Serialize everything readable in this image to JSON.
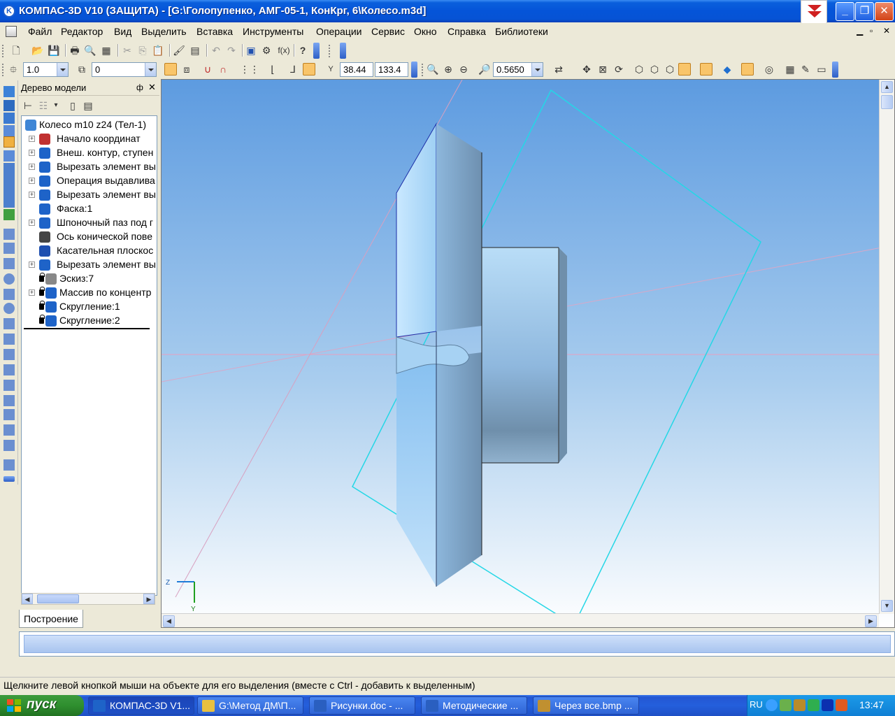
{
  "window": {
    "title": "КОМПАС-3D V10 (ЗАЩИТА) - [G:\\Голопупенко, АМГ-05-1, КонКрг, 6\\Колесо.m3d]",
    "app_icon_letter": "K"
  },
  "menubar": {
    "items": [
      "Файл",
      "Редактор",
      "Вид",
      "Выделить",
      "Вставка",
      "Инструменты",
      "Операции",
      "Сервис",
      "Окно",
      "Справка",
      "Библиотеки"
    ]
  },
  "toolbar2": {
    "step_value": "1.0",
    "layer_value": "0",
    "coord_x": "38.44",
    "coord_y": "133.4",
    "zoom_value": "0.5650",
    "fx_label": "f(x)"
  },
  "model_tree": {
    "header": "Дерево модели",
    "pin_glyph": "ф",
    "root": "Колесо m10 z24 (Тел-1)",
    "items": [
      {
        "label": "Начало координат",
        "expandable": true,
        "locked": false
      },
      {
        "label": "Внеш. контур, ступен",
        "expandable": true,
        "locked": false
      },
      {
        "label": "Вырезать элемент вы",
        "expandable": true,
        "locked": false
      },
      {
        "label": "Операция выдавлива",
        "expandable": true,
        "locked": false
      },
      {
        "label": "Вырезать элемент вы",
        "expandable": true,
        "locked": false
      },
      {
        "label": "Фаска:1",
        "expandable": false,
        "locked": false
      },
      {
        "label": "Шпоночный паз под г",
        "expandable": true,
        "locked": false
      },
      {
        "label": "Ось конической пове",
        "expandable": false,
        "locked": false
      },
      {
        "label": "Касательная плоскос",
        "expandable": false,
        "locked": false
      },
      {
        "label": "Вырезать элемент вы",
        "expandable": true,
        "locked": false
      },
      {
        "label": "Эскиз:7",
        "expandable": false,
        "locked": true
      },
      {
        "label": "Массив по концентр",
        "expandable": true,
        "locked": true
      },
      {
        "label": "Скругление:1",
        "expandable": false,
        "locked": true
      },
      {
        "label": "Скругление:2",
        "expandable": false,
        "locked": true
      }
    ],
    "tab": "Построение"
  },
  "viewport": {
    "axis_z": "Z",
    "axis_y": "Y"
  },
  "status": {
    "prompt": "Щелкните левой кнопкой мыши на объекте для его выделения (вместе с Ctrl - добавить к выделенным)"
  },
  "taskbar": {
    "start_label": "пуск",
    "tasks": [
      {
        "label": "КОМПАС-3D V1...",
        "active": true,
        "icon": "kompas-icon"
      },
      {
        "label": "G:\\Метод ДМ\\П...",
        "active": false,
        "icon": "folder-icon"
      },
      {
        "label": "Рисунки.doc - ...",
        "active": false,
        "icon": "word-icon"
      },
      {
        "label": "Методические ...",
        "active": false,
        "icon": "word-icon"
      },
      {
        "label": "Через все.bmp ...",
        "active": false,
        "icon": "paint-icon"
      }
    ],
    "lang": "RU",
    "clock": "13:47"
  },
  "colors": {
    "viewport_top": "#5d9be0",
    "viewport_bottom": "#ffffff",
    "plane_outline": "#24d7e6",
    "pink_line": "#e8a0c0",
    "part_light": "#b5dcf8",
    "part_mid": "#8cbde9",
    "part_dark": "#5d7f9e"
  }
}
